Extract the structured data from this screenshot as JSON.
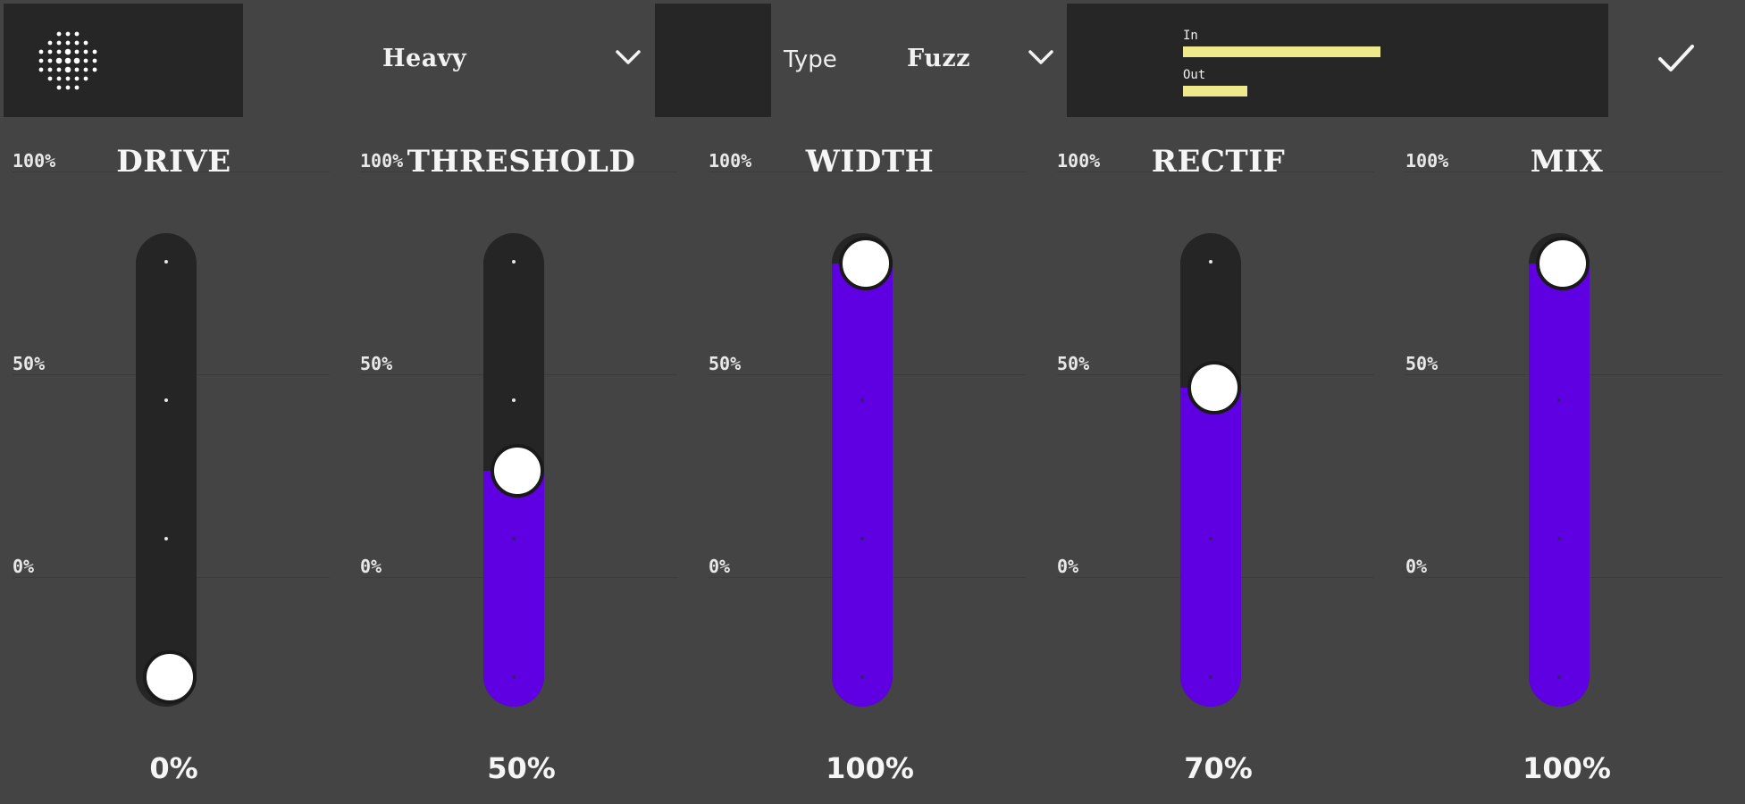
{
  "preset": {
    "value": "Heavy",
    "chevron_icon": "chevron-down-icon"
  },
  "type": {
    "label": "Type",
    "value": "Fuzz",
    "chevron_icon": "chevron-down-icon"
  },
  "meter": {
    "in_label": "In",
    "out_label": "Out",
    "in_level": 0.46,
    "out_level": 0.15,
    "color": "#eeea8c"
  },
  "confirm": {
    "icon": "check-icon"
  },
  "logo": {
    "icon": "dot-grid-logo-icon"
  },
  "scale": {
    "top": "100%",
    "mid": "50%",
    "bottom": "0%"
  },
  "accent_color": "#5f00e3",
  "sliders": [
    {
      "title": "DRIVE",
      "value": "0%",
      "level": 0.0
    },
    {
      "title": "THRESHOLD",
      "value": "50%",
      "level": 0.5
    },
    {
      "title": "WIDTH",
      "value": "100%",
      "level": 1.0
    },
    {
      "title": "RECTIF",
      "value": "70%",
      "level": 0.7
    },
    {
      "title": "MIX",
      "value": "100%",
      "level": 1.0
    }
  ]
}
